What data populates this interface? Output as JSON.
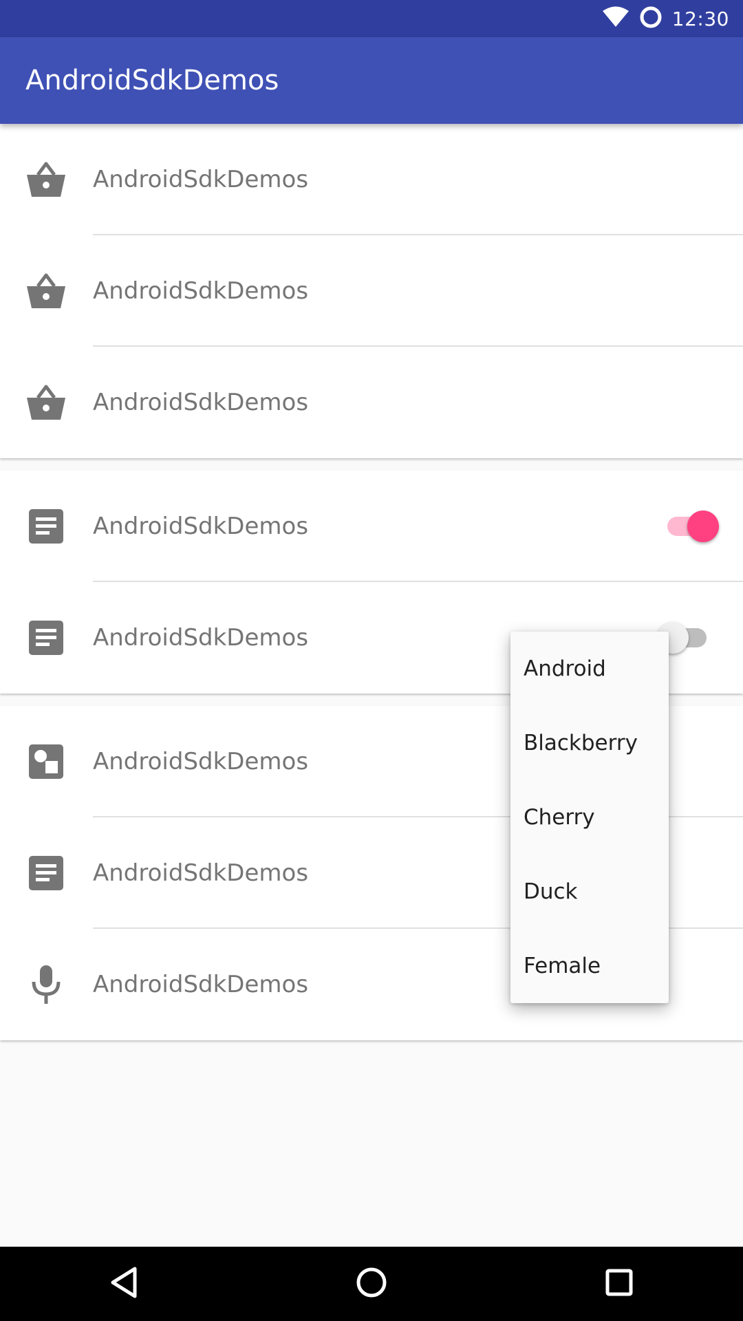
{
  "status_bar": {
    "time": "12:30",
    "icons": [
      "wifi-icon",
      "circle-status-icon"
    ],
    "background": "#303f9f"
  },
  "app_bar": {
    "title": "AndroidSdkDemos",
    "background": "#3f51b5"
  },
  "sections": [
    {
      "rows": [
        {
          "icon": "basket-icon",
          "label": "AndroidSdkDemos"
        },
        {
          "icon": "basket-icon",
          "label": "AndroidSdkDemos"
        },
        {
          "icon": "basket-icon",
          "label": "AndroidSdkDemos"
        }
      ]
    },
    {
      "rows": [
        {
          "icon": "document-icon",
          "label": "AndroidSdkDemos",
          "switch": "on"
        },
        {
          "icon": "document-icon",
          "label": "AndroidSdkDemos",
          "switch": "off"
        }
      ]
    },
    {
      "rows": [
        {
          "icon": "shapes-icon",
          "label": "AndroidSdkDemos"
        },
        {
          "icon": "document-icon",
          "label": "AndroidSdkDemos"
        },
        {
          "icon": "microphone-icon",
          "label": "AndroidSdkDemos"
        }
      ]
    }
  ],
  "popup_menu": {
    "items": [
      "Android",
      "Blackberry",
      "Cherry",
      "Duck",
      "Female"
    ]
  },
  "nav_bar": {
    "buttons": [
      "back-icon",
      "home-icon",
      "recents-icon"
    ]
  },
  "colors": {
    "accent": "#ff4081",
    "accent_track": "#ffb8d0",
    "icon_gray": "#757575",
    "switch_off_thumb": "#f1f1f1",
    "switch_off_track": "#bdbdbd"
  }
}
